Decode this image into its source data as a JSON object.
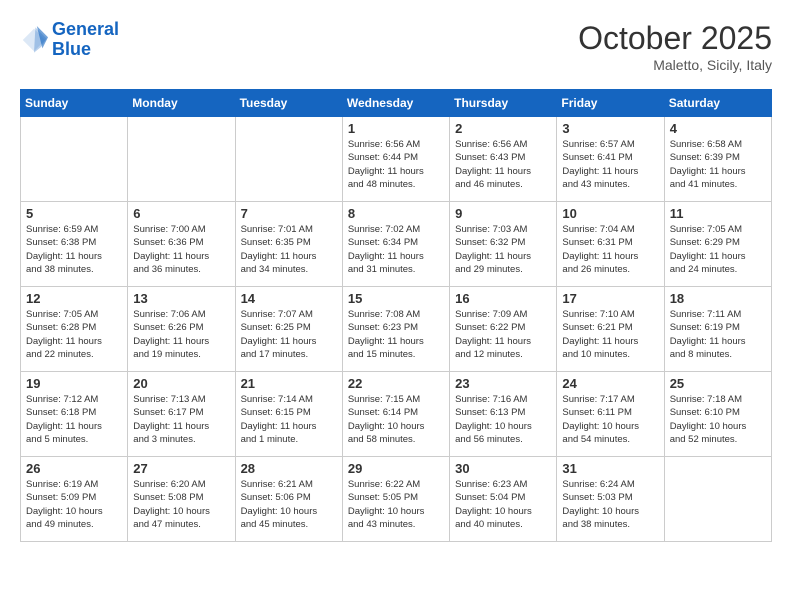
{
  "logo": {
    "line1": "General",
    "line2": "Blue"
  },
  "title": "October 2025",
  "subtitle": "Maletto, Sicily, Italy",
  "days_header": [
    "Sunday",
    "Monday",
    "Tuesday",
    "Wednesday",
    "Thursday",
    "Friday",
    "Saturday"
  ],
  "weeks": [
    [
      {
        "num": "",
        "info": ""
      },
      {
        "num": "",
        "info": ""
      },
      {
        "num": "",
        "info": ""
      },
      {
        "num": "1",
        "info": "Sunrise: 6:56 AM\nSunset: 6:44 PM\nDaylight: 11 hours\nand 48 minutes."
      },
      {
        "num": "2",
        "info": "Sunrise: 6:56 AM\nSunset: 6:43 PM\nDaylight: 11 hours\nand 46 minutes."
      },
      {
        "num": "3",
        "info": "Sunrise: 6:57 AM\nSunset: 6:41 PM\nDaylight: 11 hours\nand 43 minutes."
      },
      {
        "num": "4",
        "info": "Sunrise: 6:58 AM\nSunset: 6:39 PM\nDaylight: 11 hours\nand 41 minutes."
      }
    ],
    [
      {
        "num": "5",
        "info": "Sunrise: 6:59 AM\nSunset: 6:38 PM\nDaylight: 11 hours\nand 38 minutes."
      },
      {
        "num": "6",
        "info": "Sunrise: 7:00 AM\nSunset: 6:36 PM\nDaylight: 11 hours\nand 36 minutes."
      },
      {
        "num": "7",
        "info": "Sunrise: 7:01 AM\nSunset: 6:35 PM\nDaylight: 11 hours\nand 34 minutes."
      },
      {
        "num": "8",
        "info": "Sunrise: 7:02 AM\nSunset: 6:34 PM\nDaylight: 11 hours\nand 31 minutes."
      },
      {
        "num": "9",
        "info": "Sunrise: 7:03 AM\nSunset: 6:32 PM\nDaylight: 11 hours\nand 29 minutes."
      },
      {
        "num": "10",
        "info": "Sunrise: 7:04 AM\nSunset: 6:31 PM\nDaylight: 11 hours\nand 26 minutes."
      },
      {
        "num": "11",
        "info": "Sunrise: 7:05 AM\nSunset: 6:29 PM\nDaylight: 11 hours\nand 24 minutes."
      }
    ],
    [
      {
        "num": "12",
        "info": "Sunrise: 7:05 AM\nSunset: 6:28 PM\nDaylight: 11 hours\nand 22 minutes."
      },
      {
        "num": "13",
        "info": "Sunrise: 7:06 AM\nSunset: 6:26 PM\nDaylight: 11 hours\nand 19 minutes."
      },
      {
        "num": "14",
        "info": "Sunrise: 7:07 AM\nSunset: 6:25 PM\nDaylight: 11 hours\nand 17 minutes."
      },
      {
        "num": "15",
        "info": "Sunrise: 7:08 AM\nSunset: 6:23 PM\nDaylight: 11 hours\nand 15 minutes."
      },
      {
        "num": "16",
        "info": "Sunrise: 7:09 AM\nSunset: 6:22 PM\nDaylight: 11 hours\nand 12 minutes."
      },
      {
        "num": "17",
        "info": "Sunrise: 7:10 AM\nSunset: 6:21 PM\nDaylight: 11 hours\nand 10 minutes."
      },
      {
        "num": "18",
        "info": "Sunrise: 7:11 AM\nSunset: 6:19 PM\nDaylight: 11 hours\nand 8 minutes."
      }
    ],
    [
      {
        "num": "19",
        "info": "Sunrise: 7:12 AM\nSunset: 6:18 PM\nDaylight: 11 hours\nand 5 minutes."
      },
      {
        "num": "20",
        "info": "Sunrise: 7:13 AM\nSunset: 6:17 PM\nDaylight: 11 hours\nand 3 minutes."
      },
      {
        "num": "21",
        "info": "Sunrise: 7:14 AM\nSunset: 6:15 PM\nDaylight: 11 hours\nand 1 minute."
      },
      {
        "num": "22",
        "info": "Sunrise: 7:15 AM\nSunset: 6:14 PM\nDaylight: 10 hours\nand 58 minutes."
      },
      {
        "num": "23",
        "info": "Sunrise: 7:16 AM\nSunset: 6:13 PM\nDaylight: 10 hours\nand 56 minutes."
      },
      {
        "num": "24",
        "info": "Sunrise: 7:17 AM\nSunset: 6:11 PM\nDaylight: 10 hours\nand 54 minutes."
      },
      {
        "num": "25",
        "info": "Sunrise: 7:18 AM\nSunset: 6:10 PM\nDaylight: 10 hours\nand 52 minutes."
      }
    ],
    [
      {
        "num": "26",
        "info": "Sunrise: 6:19 AM\nSunset: 5:09 PM\nDaylight: 10 hours\nand 49 minutes."
      },
      {
        "num": "27",
        "info": "Sunrise: 6:20 AM\nSunset: 5:08 PM\nDaylight: 10 hours\nand 47 minutes."
      },
      {
        "num": "28",
        "info": "Sunrise: 6:21 AM\nSunset: 5:06 PM\nDaylight: 10 hours\nand 45 minutes."
      },
      {
        "num": "29",
        "info": "Sunrise: 6:22 AM\nSunset: 5:05 PM\nDaylight: 10 hours\nand 43 minutes."
      },
      {
        "num": "30",
        "info": "Sunrise: 6:23 AM\nSunset: 5:04 PM\nDaylight: 10 hours\nand 40 minutes."
      },
      {
        "num": "31",
        "info": "Sunrise: 6:24 AM\nSunset: 5:03 PM\nDaylight: 10 hours\nand 38 minutes."
      },
      {
        "num": "",
        "info": ""
      }
    ]
  ]
}
